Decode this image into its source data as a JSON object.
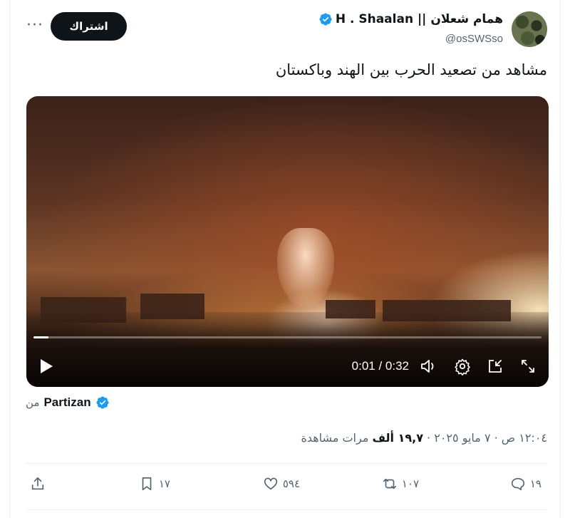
{
  "tweet": {
    "author": {
      "display_name": "H . Shaalan || همام شعلان",
      "handle": "@osSWSso",
      "verified": true,
      "verified_color": "#1d9bf0"
    },
    "subscribe_label": "اشتراك",
    "more_label": "···",
    "text": "مشاهد من تصعيد الحرب بين الهند وباكستان",
    "video": {
      "time": "0:01 / 0:32",
      "progress": 0.03
    },
    "source": {
      "from_label": "من",
      "name": "Partizan",
      "verified": true
    },
    "meta": {
      "time_date": "١٢:٠٤ ص · ٧ مايو ٢٠٢٥ · ",
      "views": "١٩,٧ ألف",
      "views_label": " مرات مشاهدة"
    },
    "actions": {
      "replies": "١٩",
      "retweets": "١٠٧",
      "likes": "٥٩٤",
      "bookmarks": "١٧"
    }
  }
}
